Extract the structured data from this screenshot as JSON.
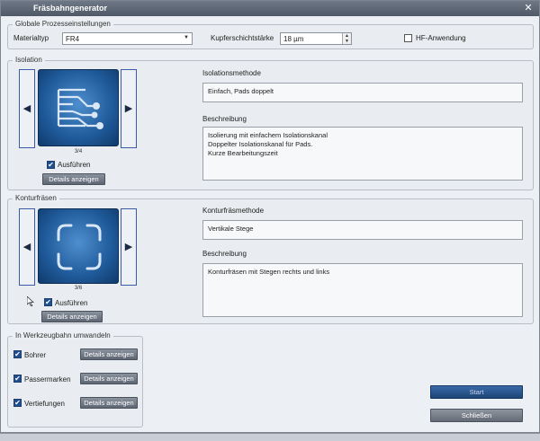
{
  "window": {
    "title": "Fräsbahngenerator",
    "close_glyph": "✕"
  },
  "global": {
    "legend": "Globale Prozesseinstellungen",
    "material_label": "Materialtyp",
    "material_value": "FR4",
    "copper_label": "Kupferschichtstärke",
    "copper_value": "18 µm",
    "hf_label": "HF-Anwendung",
    "hf_checked": false
  },
  "isolation": {
    "legend": "Isolation",
    "counter": "3/4",
    "execute_label": "Ausführen",
    "execute_checked": true,
    "details_label": "Details anzeigen",
    "method_label": "Isolationsmethode",
    "method_value": "Einfach, Pads doppelt",
    "description_label": "Beschreibung",
    "description_lines": [
      "Isolierung mit einfachem Isolationskanal",
      "Doppelter Isolationskanal für Pads.",
      "Kurze Bearbeitungszeit"
    ],
    "prev_glyph": "◀",
    "next_glyph": "▶"
  },
  "contour": {
    "legend": "Konturfräsen",
    "counter": "3/6",
    "execute_label": "Ausführen",
    "execute_checked": true,
    "details_label": "Details anzeigen",
    "method_label": "Konturfräsmethode",
    "method_value": "Vertikale Stege",
    "description_label": "Beschreibung",
    "description_lines": [
      "Konturfräsen mit Stegen rechts und links"
    ],
    "prev_glyph": "◀",
    "next_glyph": "▶"
  },
  "toolpath": {
    "legend": "In Werkzeugbahn umwandeln",
    "items": [
      {
        "label": "Bohrer",
        "checked": true,
        "details_label": "Details anzeigen"
      },
      {
        "label": "Passermarken",
        "checked": true,
        "details_label": "Details anzeigen"
      },
      {
        "label": "Vertiefungen",
        "checked": true,
        "details_label": "Details anzeigen"
      }
    ]
  },
  "actions": {
    "start_label": "Start",
    "close_label": "Schließen"
  },
  "colors": {
    "accent": "#1f4f8f",
    "preview": "#1f5a9a",
    "frame": "#3b5aa8"
  }
}
